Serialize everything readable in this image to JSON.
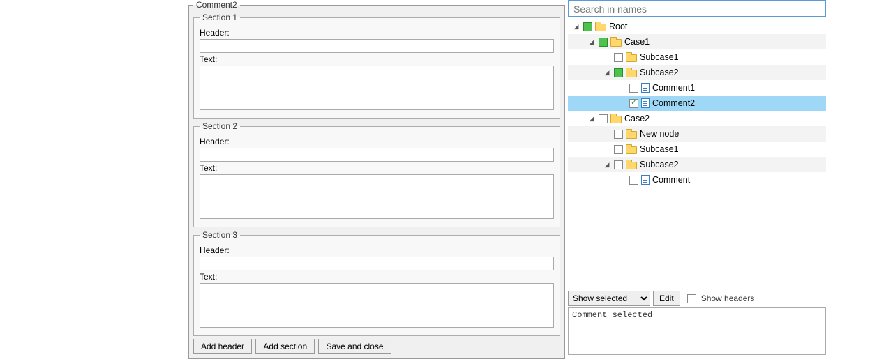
{
  "editor": {
    "title": "Comment2",
    "sections": [
      {
        "legend": "Section 1",
        "header_label": "Header:",
        "header_value": "",
        "text_label": "Text:",
        "text_value": ""
      },
      {
        "legend": "Section 2",
        "header_label": "Header:",
        "header_value": "",
        "text_label": "Text:",
        "text_value": ""
      },
      {
        "legend": "Section 3",
        "header_label": "Header:",
        "header_value": "",
        "text_label": "Text:",
        "text_value": ""
      }
    ],
    "buttons": {
      "add_header": "Add header",
      "add_section": "Add section",
      "save_close": "Save and close"
    }
  },
  "search": {
    "placeholder": "Search in names"
  },
  "tree": [
    {
      "indent": 0,
      "expander": "expanded",
      "check": "green",
      "icon": "folder",
      "label": "Root",
      "alt": false,
      "selected": false
    },
    {
      "indent": 1,
      "expander": "expanded",
      "check": "green",
      "icon": "folder",
      "label": "Case1",
      "alt": true,
      "selected": false
    },
    {
      "indent": 2,
      "expander": "none",
      "check": "empty",
      "icon": "folder",
      "label": "Subcase1",
      "alt": false,
      "selected": false
    },
    {
      "indent": 2,
      "expander": "expanded",
      "check": "green",
      "icon": "folder",
      "label": "Subcase2",
      "alt": true,
      "selected": false
    },
    {
      "indent": 3,
      "expander": "none",
      "check": "empty",
      "icon": "doc",
      "label": "Comment1",
      "alt": false,
      "selected": false
    },
    {
      "indent": 3,
      "expander": "none",
      "check": "checked",
      "icon": "doc",
      "label": "Comment2",
      "alt": true,
      "selected": true
    },
    {
      "indent": 1,
      "expander": "expanded",
      "check": "empty",
      "icon": "folder",
      "label": "Case2",
      "alt": false,
      "selected": false
    },
    {
      "indent": 2,
      "expander": "none",
      "check": "empty",
      "icon": "folder",
      "label": "New node",
      "alt": true,
      "selected": false
    },
    {
      "indent": 2,
      "expander": "none",
      "check": "empty",
      "icon": "folder",
      "label": "Subcase1",
      "alt": false,
      "selected": false
    },
    {
      "indent": 2,
      "expander": "expanded",
      "check": "empty",
      "icon": "folder",
      "label": "Subcase2",
      "alt": true,
      "selected": false
    },
    {
      "indent": 3,
      "expander": "none",
      "check": "empty",
      "icon": "doc",
      "label": "Comment",
      "alt": false,
      "selected": false
    }
  ],
  "controls": {
    "select_option": "Show selected",
    "edit_button": "Edit",
    "show_headers_label": "Show headers"
  },
  "status": "Comment selected"
}
